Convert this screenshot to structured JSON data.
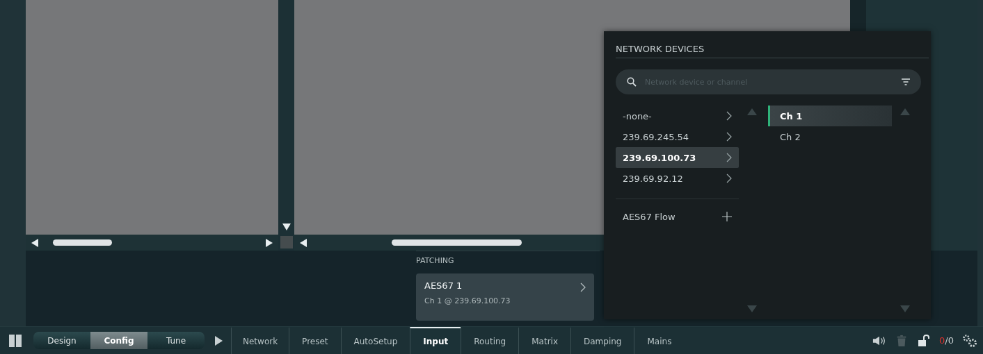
{
  "network_devices": {
    "title": "NETWORK DEVICES",
    "search": {
      "placeholder": "Network device or channel"
    },
    "devices": [
      {
        "label": "-none-",
        "selected": false
      },
      {
        "label": "239.69.245.54",
        "selected": false
      },
      {
        "label": "239.69.100.73",
        "selected": true
      },
      {
        "label": "239.69.92.12",
        "selected": false
      }
    ],
    "flow": {
      "label": "AES67 Flow"
    },
    "channels": [
      {
        "label": "Ch 1",
        "selected": true
      },
      {
        "label": "Ch 2",
        "selected": false
      }
    ]
  },
  "patching": {
    "title": "PATCHING",
    "card": {
      "name": "AES67 1",
      "detail": "Ch 1 @ 239.69.100.73"
    }
  },
  "modes": [
    {
      "label": "Design",
      "selected": false
    },
    {
      "label": "Config",
      "selected": true
    },
    {
      "label": "Tune",
      "selected": false
    }
  ],
  "tabs": [
    {
      "label": "Network",
      "selected": false
    },
    {
      "label": "Preset",
      "selected": false
    },
    {
      "label": "AutoSetup",
      "selected": false
    },
    {
      "label": "Input",
      "selected": true
    },
    {
      "label": "Routing",
      "selected": false
    },
    {
      "label": "Matrix",
      "selected": false
    },
    {
      "label": "Damping",
      "selected": false
    },
    {
      "label": "Mains",
      "selected": false
    }
  ],
  "status": {
    "error_count": "0",
    "total": "/0"
  }
}
